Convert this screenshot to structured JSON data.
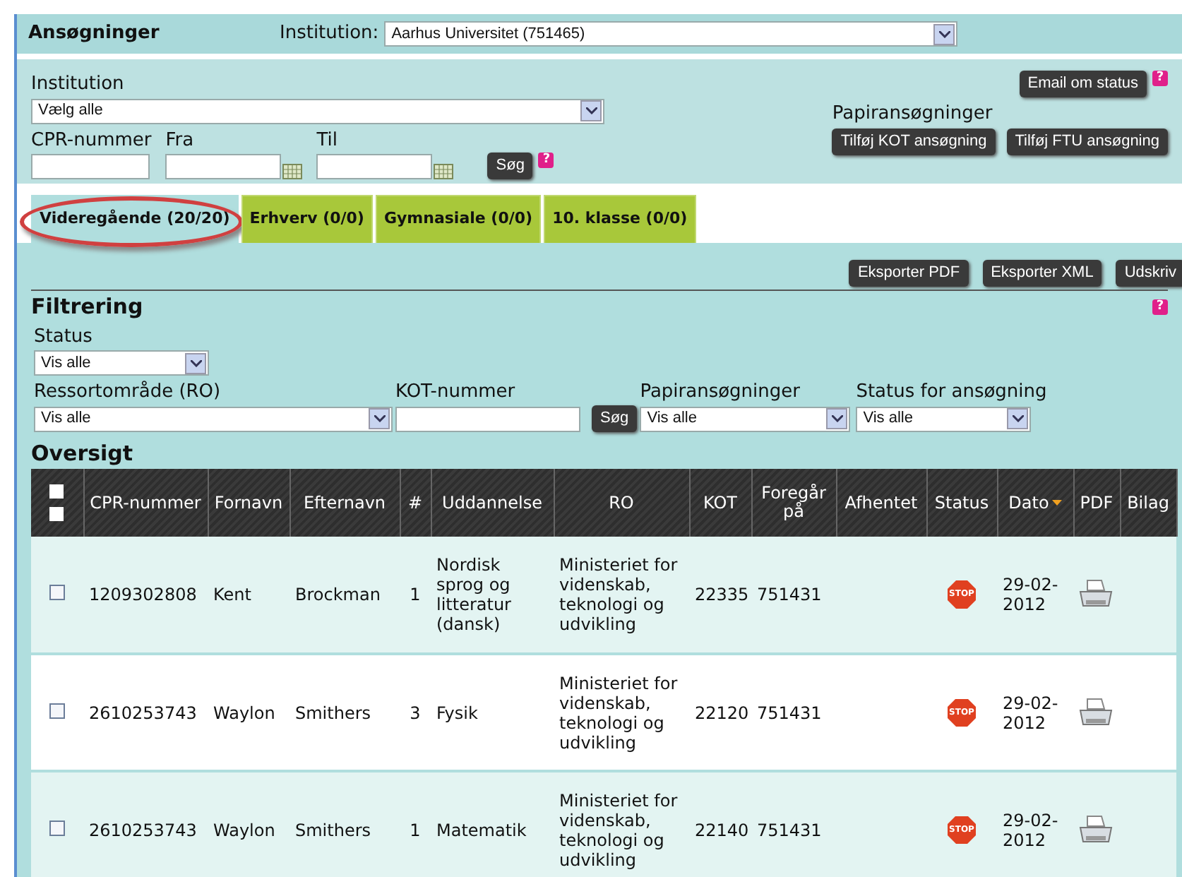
{
  "header": {
    "title": "Ansøgninger",
    "institution_label": "Institution:",
    "institution_value": "Aarhus Universitet (751465)"
  },
  "search": {
    "institution_label": "Institution",
    "institution_value": "Vælg alle",
    "cpr_label": "CPR-nummer",
    "from_label": "Fra",
    "to_label": "Til",
    "search_button": "Søg",
    "help": "?",
    "email_button": "Email om status",
    "email_help": "?",
    "paper_label": "Papiransøgninger",
    "add_kot_button": "Tilføj KOT ansøgning",
    "add_ftu_button": "Tilføj FTU ansøgning"
  },
  "tabs": [
    {
      "label": "Videregående (20/20)",
      "selected": true,
      "highlighted": true
    },
    {
      "label": "Erhverv (0/0)",
      "selected": false,
      "highlighted": false
    },
    {
      "label": "Gymnasiale (0/0)",
      "selected": false,
      "highlighted": false
    },
    {
      "label": "10. klasse (0/0)",
      "selected": false,
      "highlighted": false
    }
  ],
  "actions": [
    "Eksporter PDF",
    "Eksporter XML",
    "Udskriv"
  ],
  "filter": {
    "title": "Filtrering",
    "help": "?",
    "status_label": "Status",
    "status_value": "Vis alle",
    "ro_label": "Ressortområde (RO)",
    "ro_value": "Vis alle",
    "kot_label": "KOT-nummer",
    "search_button": "Søg",
    "paper_label": "Papiransøgninger",
    "paper_value": "Vis alle",
    "app_status_label": "Status for ansøgning",
    "app_status_value": "Vis alle"
  },
  "overview": {
    "title": "Oversigt",
    "columns": [
      {
        "label": "CPR-nummer",
        "sorted": false
      },
      {
        "label": "Fornavn",
        "sorted": false
      },
      {
        "label": "Efternavn",
        "sorted": false
      },
      {
        "label": "#",
        "sorted": false
      },
      {
        "label": "Uddannelse",
        "sorted": false
      },
      {
        "label": "RO",
        "sorted": false
      },
      {
        "label": "KOT",
        "sorted": false
      },
      {
        "label": "Foregår på",
        "sorted": false
      },
      {
        "label": "Afhentet",
        "sorted": false
      },
      {
        "label": "Status",
        "sorted": false
      },
      {
        "label": "Dato",
        "sorted": true
      },
      {
        "label": "PDF",
        "sorted": false
      },
      {
        "label": "Bilag",
        "sorted": false
      }
    ],
    "select_all": [
      {
        "checked": false
      },
      {
        "checked": false
      }
    ],
    "rows": [
      {
        "checked": false,
        "status": "STOP",
        "cells": [
          "1209302808",
          "Kent",
          "Brockman",
          "1",
          "Nordisk sprog og litteratur (dansk)",
          "Ministeriet for videnskab, teknologi og udvikling",
          "22335",
          "751431",
          "",
          "",
          "29-02-2012"
        ]
      },
      {
        "checked": false,
        "status": "STOP",
        "cells": [
          "2610253743",
          "Waylon",
          "Smithers",
          "3",
          "Fysik",
          "Ministeriet for videnskab, teknologi og udvikling",
          "22120",
          "751431",
          "",
          "",
          "29-02-2012"
        ]
      },
      {
        "checked": false,
        "status": "STOP",
        "cells": [
          "2610253743",
          "Waylon",
          "Smithers",
          "1",
          "Matematik",
          "Ministeriet for videnskab, teknologi og udvikling",
          "22140",
          "751431",
          "",
          "",
          "29-02-2012"
        ]
      }
    ]
  }
}
